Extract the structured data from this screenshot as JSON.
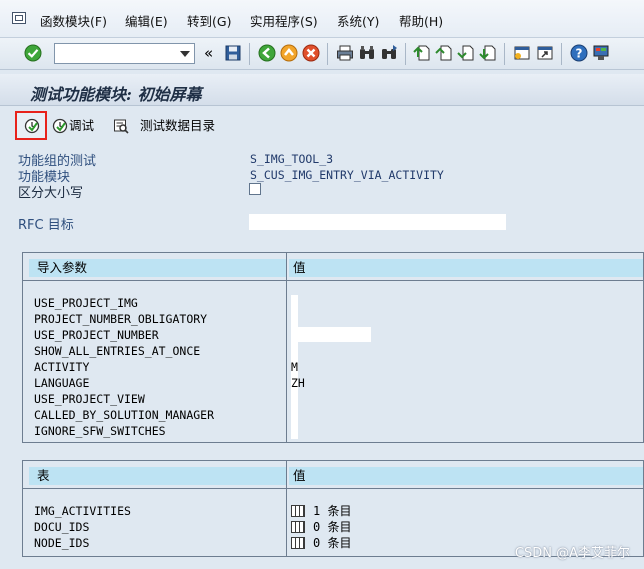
{
  "menubar": {
    "items": [
      {
        "label": "函数模块(F)"
      },
      {
        "label": "编辑(E)"
      },
      {
        "label": "转到(G)"
      },
      {
        "label": "实用程序(S)"
      },
      {
        "label": "系统(Y)"
      },
      {
        "label": "帮助(H)"
      }
    ]
  },
  "toolbar": {
    "command_field": {
      "value": "",
      "placeholder": ""
    },
    "collapse_glyph": "«"
  },
  "title": "测试功能模块: 初始屏幕",
  "app_toolbar": {
    "debug_label": "调试",
    "test_data_dir_label": "测试数据目录"
  },
  "header": {
    "function_group_label": "功能组的测试",
    "function_group_value": "S_IMG_TOOL_3",
    "function_module_label": "功能模块",
    "function_module_value": "S_CUS_IMG_ENTRY_VIA_ACTIVITY",
    "case_sensitive_label": "区分大小写",
    "rfc_target_label": "RFC 目标"
  },
  "import_params": {
    "header_name": "导入参数",
    "header_value": "值",
    "rows": [
      {
        "name": "USE_PROJECT_IMG",
        "value": ""
      },
      {
        "name": "PROJECT_NUMBER_OBLIGATORY",
        "value": ""
      },
      {
        "name": "USE_PROJECT_NUMBER",
        "value": ""
      },
      {
        "name": "SHOW_ALL_ENTRIES_AT_ONCE",
        "value": ""
      },
      {
        "name": "ACTIVITY",
        "value": "M"
      },
      {
        "name": "LANGUAGE",
        "value": "ZH"
      },
      {
        "name": "USE_PROJECT_VIEW",
        "value": ""
      },
      {
        "name": "CALLED_BY_SOLUTION_MANAGER",
        "value": ""
      },
      {
        "name": "IGNORE_SFW_SWITCHES",
        "value": ""
      }
    ]
  },
  "tables": {
    "header_name": "表",
    "header_value": "值",
    "rows": [
      {
        "name": "IMG_ACTIVITIES",
        "count": "1 条目"
      },
      {
        "name": "DOCU_IDS",
        "count": "0 条目"
      },
      {
        "name": "NODE_IDS",
        "count": "0 条目"
      }
    ]
  },
  "watermark": "CSDN @A李艾菲尔",
  "colors": {
    "background": "#dfe8f1",
    "header_cell": "#bde3f3",
    "label_text": "#2f4f7e",
    "highlight_border": "#e8221b"
  }
}
